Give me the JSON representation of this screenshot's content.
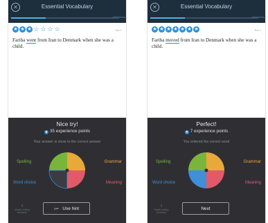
{
  "screens": [
    {
      "header": {
        "title": "Essential Vocabulary",
        "progress_count": "4/10 items",
        "progress": 0.32
      },
      "rating": {
        "filled": 3,
        "total": 7
      },
      "set_label": "Set 1",
      "sentence": {
        "before": "Fariba ",
        "answer": "went",
        "after": "  from Iran to Denmark when she was a child."
      },
      "feedback": {
        "title": "Nice try!",
        "points": "35 experience points",
        "subtitle": "Your answer is close to the correct answer",
        "skills": {
          "spelling": "Spelling",
          "grammar": "Grammar",
          "word_choice": "Word choice",
          "meaning": "Meaning"
        },
        "petals_active": {
          "spelling": true,
          "grammar": true,
          "word_choice": false,
          "meaning": true
        },
        "mystery_label": "Watch writing feedback",
        "button_label": "Use hint"
      }
    },
    {
      "header": {
        "title": "Essential Vocabulary",
        "progress_count": "4/10 items",
        "progress": 0.32
      },
      "rating": {
        "filled": 7,
        "total": 7
      },
      "set_label": "Set 1",
      "sentence": {
        "before": "Fariba ",
        "answer": "moved",
        "after": " from Iran to Denmark when she was a child."
      },
      "feedback": {
        "title": "Perfect!",
        "points": "7 experience points",
        "subtitle": "You entered the correct word",
        "skills": {
          "spelling": "Spelling",
          "grammar": "Grammar",
          "word_choice": "Word choice",
          "meaning": "Meaning"
        },
        "petals_active": {
          "spelling": true,
          "grammar": true,
          "word_choice": true,
          "meaning": true
        },
        "mystery_label": "Watch writing feedback",
        "button_label": "Next"
      }
    }
  ],
  "icons": {
    "close": "close-icon",
    "xp": "xp-icon",
    "hint": "hint-icon",
    "mystery": "mystery-icon",
    "star": "star-icon"
  },
  "colors": {
    "accent": "#2b8fd9",
    "spelling": "#7ab53b",
    "grammar": "#e9a83a",
    "word_choice": "#3f8fd9",
    "meaning": "#e25a69"
  }
}
